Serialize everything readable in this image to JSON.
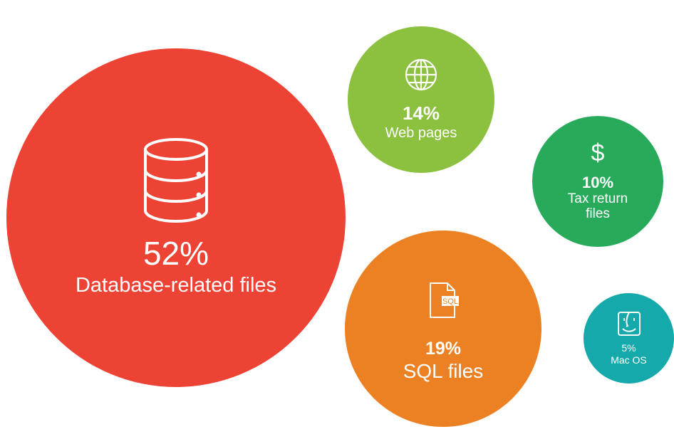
{
  "chart_data": {
    "type": "bubble",
    "unit": "%",
    "series": [
      {
        "label": "Database-related files",
        "percent_text": "52%",
        "value": 52,
        "color": "#ec4335",
        "icon": "database-icon"
      },
      {
        "label": "Web pages",
        "percent_text": "14%",
        "value": 14,
        "color": "#8cc13f",
        "icon": "globe-icon"
      },
      {
        "label": "Tax return files",
        "label_lines": [
          "Tax return",
          "files"
        ],
        "percent_text": "10%",
        "value": 10,
        "color": "#27ab5b",
        "icon": "dollar-icon"
      },
      {
        "label": "SQL files",
        "percent_text": "19%",
        "value": 19,
        "color": "#ec8124",
        "icon": "sql-file-icon",
        "icon_text": "SQL"
      },
      {
        "label": "Mac OS",
        "percent_text": "5%",
        "value": 5,
        "color": "#16a9ac",
        "icon": "mac-finder-icon"
      }
    ]
  },
  "icons": {
    "dollar_glyph": "$"
  }
}
